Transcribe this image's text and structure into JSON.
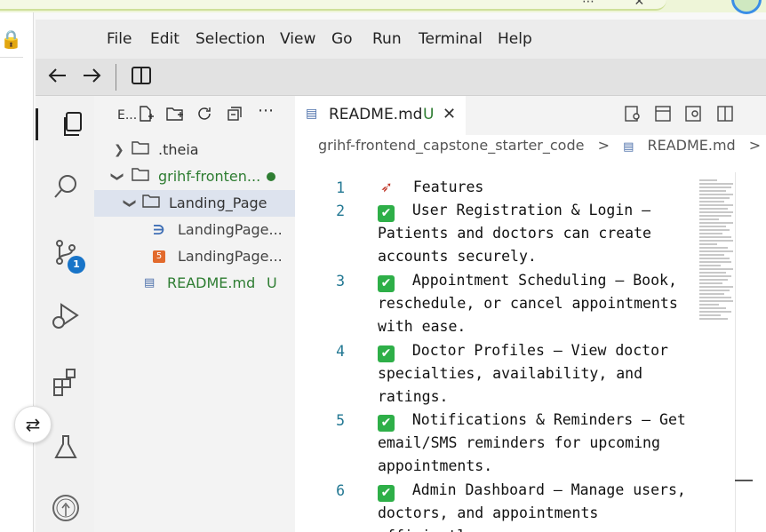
{
  "menu": [
    "File",
    "Edit",
    "Selection",
    "View",
    "Go",
    "Run",
    "Terminal",
    "Help"
  ],
  "explorer": {
    "title": "E...",
    "tree": [
      {
        "label": ".theia",
        "type": "folder",
        "expanded": false,
        "indent": 0
      },
      {
        "label": "grihf-fronten...",
        "type": "folder",
        "expanded": true,
        "indent": 0,
        "modified": true
      },
      {
        "label": "Landing_Page",
        "type": "folder",
        "expanded": true,
        "indent": 1,
        "selected": true
      },
      {
        "label": "LandingPage...",
        "type": "css-file",
        "indent": 2
      },
      {
        "label": "LandingPage...",
        "type": "html-file",
        "indent": 2
      },
      {
        "label": "README.md",
        "type": "md-file",
        "indent": 1,
        "status": "U"
      }
    ]
  },
  "activity": {
    "scm_badge": "1"
  },
  "tab": {
    "label": "README.md",
    "status": "U"
  },
  "breadcrumbs": [
    "grihf-frontend_capstone_starter_code",
    ">",
    "README.md",
    ">"
  ],
  "code_lines": [
    {
      "num": "1",
      "icon": "rocket",
      "text": "Features"
    },
    {
      "num": "2",
      "icon": "check",
      "text": "User Registration & Login – Patients and doctors can create accounts securely."
    },
    {
      "num": "3",
      "icon": "check",
      "text": "Appointment Scheduling – Book, reschedule, or cancel appointments with ease."
    },
    {
      "num": "4",
      "icon": "check",
      "text": "Doctor Profiles – View doctor specialties, availability, and ratings."
    },
    {
      "num": "5",
      "icon": "check",
      "text": "Notifications & Reminders – Get email/SMS reminders for upcoming appointments."
    },
    {
      "num": "6",
      "icon": "check",
      "text": "Admin Dashboard – Manage users, doctors, and appointments efficiently."
    }
  ],
  "colors": {
    "accent": "#1874c8",
    "git_added": "#2e7d32",
    "line_number": "#237893"
  }
}
